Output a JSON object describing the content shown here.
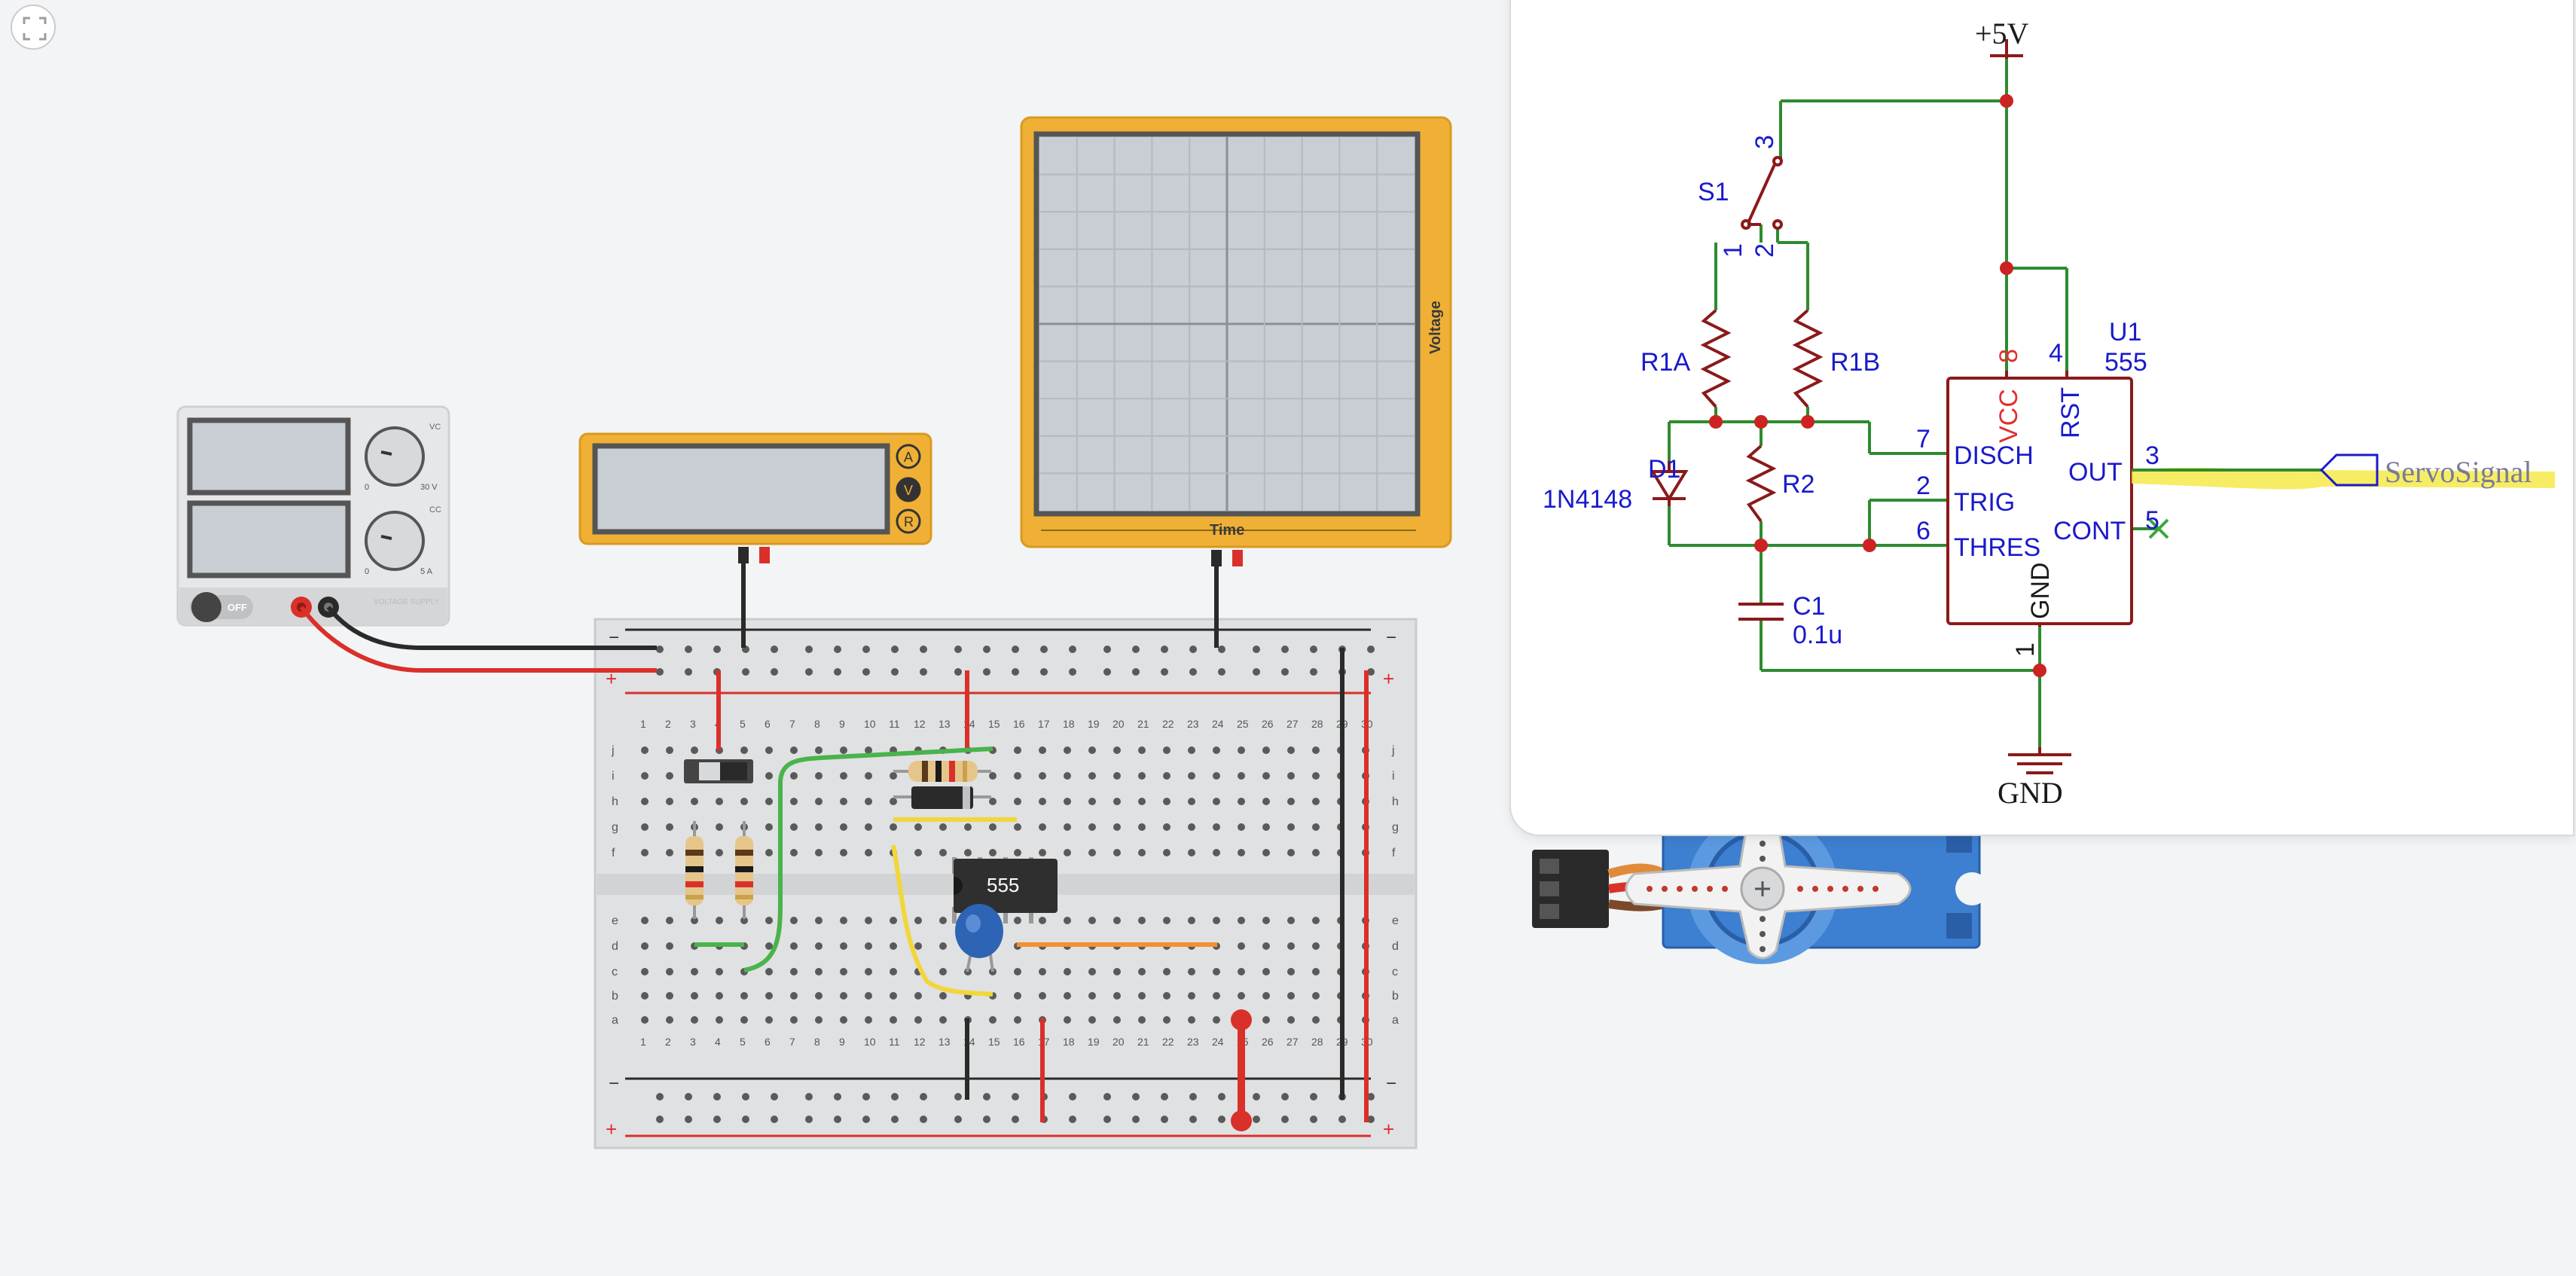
{
  "toolbar": {
    "fit_view_icon": "fit-to-view-icon"
  },
  "power_supply": {
    "switch_label": "OFF",
    "voltage_scale_min": "0",
    "voltage_scale_max": "30 V",
    "current_scale_min": "0",
    "current_scale_max": "5 A",
    "vc_label": "VC",
    "cc_label": "CC",
    "brand_label": "VOLTAGE SUPPLY",
    "color": "#e6e7e8"
  },
  "multimeter": {
    "modes": [
      "A",
      "V",
      "R"
    ],
    "color": "#efb035"
  },
  "oscilloscope": {
    "x_label": "Time",
    "y_label": "Voltage",
    "color": "#efb035"
  },
  "breadboard": {
    "column_numbers": [
      "1",
      "2",
      "3",
      "4",
      "5",
      "6",
      "7",
      "8",
      "9",
      "10",
      "11",
      "12",
      "13",
      "14",
      "15",
      "16",
      "17",
      "18",
      "19",
      "20",
      "21",
      "22",
      "23",
      "24",
      "25",
      "26",
      "27",
      "28",
      "29",
      "30"
    ],
    "row_letters_top": [
      "j",
      "i",
      "h",
      "g",
      "f"
    ],
    "row_letters_bottom": [
      "e",
      "d",
      "c",
      "b",
      "a"
    ],
    "rail_minus": "−",
    "rail_plus": "+",
    "chip_label": "555",
    "colors": {
      "red": "#d9302a",
      "black": "#2a2a2a",
      "green": "#4ab34c",
      "yellow": "#f2d63a",
      "orange": "#f0922e",
      "capacitor": "#2d64b3"
    }
  },
  "servo": {
    "icon": "servo-motor-icon",
    "color": "#3d7fd0"
  },
  "schematic": {
    "vcc_label": "+5V",
    "gnd_label": "GND",
    "switch_ref": "S1",
    "switch_pins": [
      "3",
      "1",
      "2"
    ],
    "r1a": "R1A",
    "r1b": "R1B",
    "r2": "R2",
    "d1_ref": "D1",
    "d1_value": "1N4148",
    "c1_ref": "C1",
    "c1_value": "0.1u",
    "u1_ref": "U1",
    "u1_value": "555",
    "pin_numbers": {
      "vcc": "8",
      "rst": "4",
      "disch": "7",
      "trig": "2",
      "thres": "6",
      "out": "3",
      "cont": "5",
      "gnd": "1"
    },
    "pin_names": {
      "vcc": "VCC",
      "rst": "RST",
      "disch": "DISCH",
      "trig": "TRIG",
      "thres": "THRES",
      "out": "OUT",
      "cont": "CONT",
      "gnd": "GND"
    },
    "net_label": "ServoSignal",
    "colors": {
      "wire": "#2e8b2e",
      "component": "#8b1a1a",
      "label": "#1a1acc",
      "node": "#cc2222",
      "highlight": "#f5ea4a"
    }
  }
}
